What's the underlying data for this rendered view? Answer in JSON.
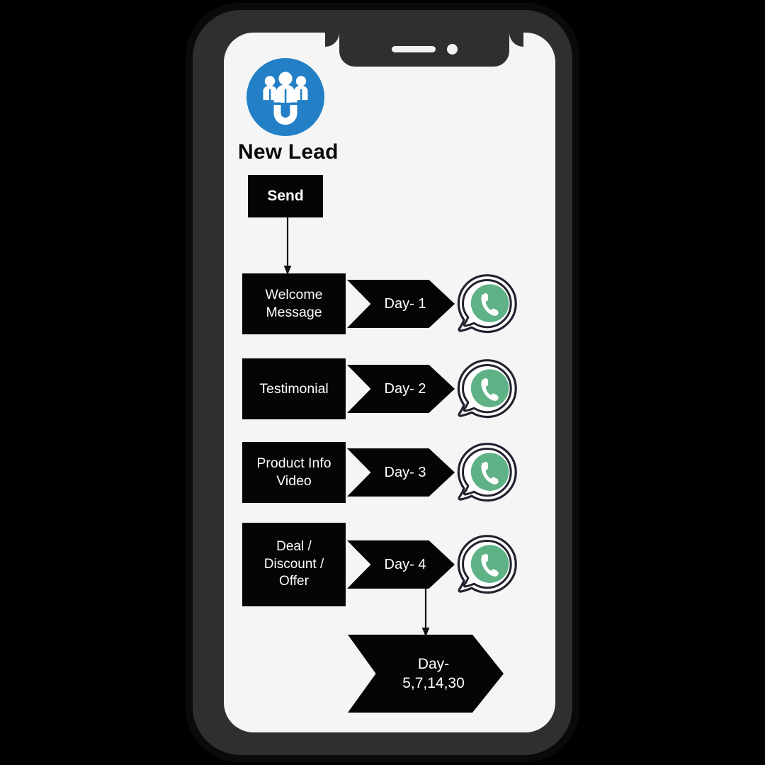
{
  "device": {
    "type": "smartphone-mockup",
    "notch": {
      "speaker": "speaker-bar",
      "camera": "front-camera-dot"
    },
    "frame_color": "#2f2f2f",
    "screen_background": "#f5f5f5"
  },
  "screen": {
    "logo": {
      "name": "lead-magnet-icon",
      "circle_color": "#2380c6",
      "glyph_color": "#ffffff",
      "description": "three people above a horseshoe magnet"
    },
    "title": "New Lead",
    "start_node": {
      "label": "Send",
      "background": "#050505",
      "text_color": "#ffffff"
    },
    "flow_rows": [
      {
        "label_lines": [
          "Welcome",
          "Message"
        ],
        "day_label": "Day- 1",
        "channel_icon": "whatsapp-icon"
      },
      {
        "label_lines": [
          "Testimonial"
        ],
        "day_label": "Day- 2",
        "channel_icon": "whatsapp-icon"
      },
      {
        "label_lines": [
          "Product Info",
          "Video"
        ],
        "day_label": "Day- 3",
        "channel_icon": "whatsapp-icon"
      },
      {
        "label_lines": [
          "Deal /",
          "Discount /",
          "Offer"
        ],
        "day_label": "Day- 4",
        "channel_icon": "whatsapp-icon"
      }
    ],
    "final_node": {
      "label_lines": [
        "Day-",
        "5,7,14,30"
      ],
      "background": "#050505",
      "text_color": "#ffffff"
    },
    "colors": {
      "node_black": "#050505",
      "accent_blue": "#2380c6",
      "whatsapp_green": "#5fb286",
      "whatsapp_outline": "#22222e",
      "connector": "#111111"
    }
  }
}
